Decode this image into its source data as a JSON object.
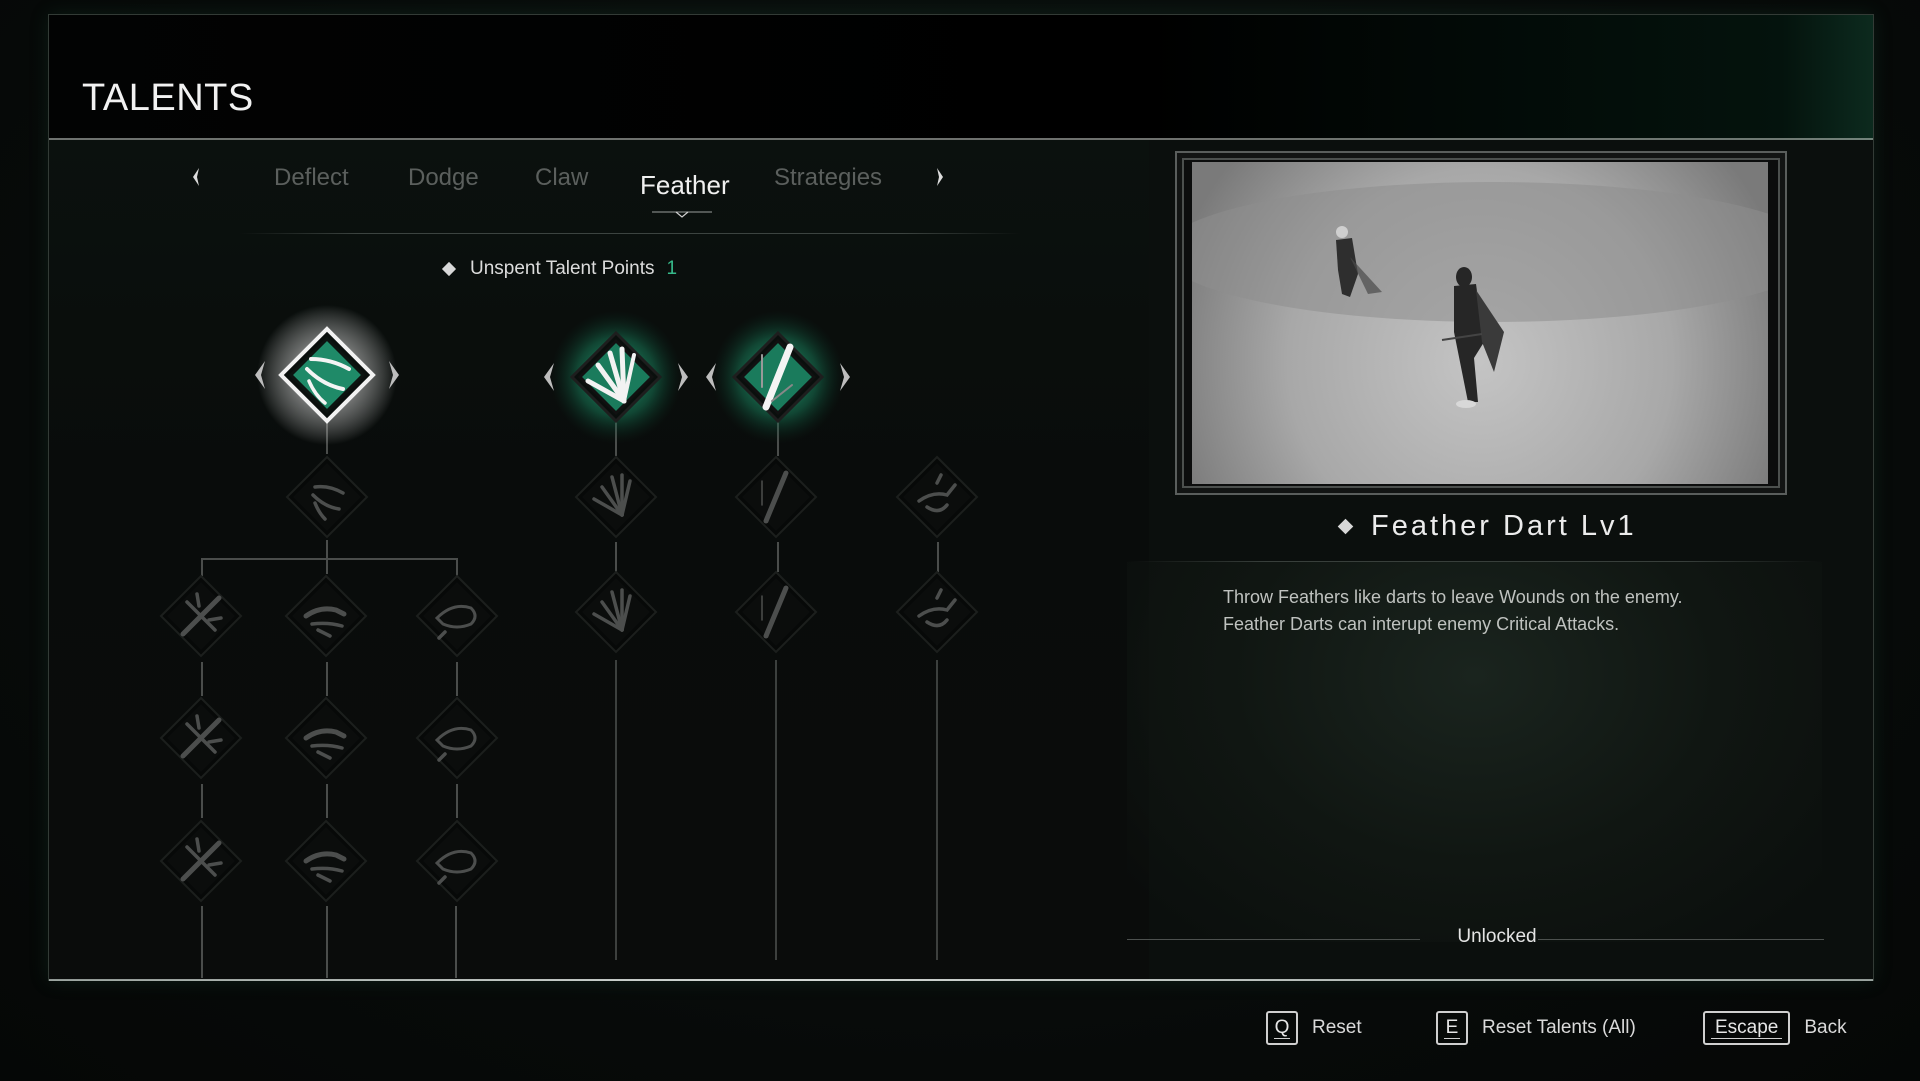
{
  "header": {
    "title": "TALENTS"
  },
  "tabs": {
    "prev_icon": "chevron-left-icon",
    "next_icon": "chevron-right-icon",
    "items": [
      {
        "label": "Deflect",
        "active": false
      },
      {
        "label": "Dodge",
        "active": false
      },
      {
        "label": "Claw",
        "active": false
      },
      {
        "label": "Feather",
        "active": true
      },
      {
        "label": "Strategies",
        "active": false
      }
    ]
  },
  "unspent": {
    "label": "Unspent Talent Points",
    "value": "1"
  },
  "tree": {
    "top_nodes": [
      {
        "id": "feather-dart",
        "state": "selected",
        "icon": "three-claws-icon",
        "has_level_arrows": true
      },
      {
        "id": "feather-fan",
        "state": "unlocked",
        "icon": "feather-fan-icon",
        "has_level_arrows": true
      },
      {
        "id": "single-feather",
        "state": "unlocked",
        "icon": "single-feather-icon",
        "has_level_arrows": true
      }
    ],
    "locked_nodes": [
      {
        "icon": "three-claws-icon"
      },
      {
        "icon": "feather-fan-icon"
      },
      {
        "icon": "single-feather-icon"
      },
      {
        "icon": "raven-icon"
      },
      {
        "icon": "crossed-feathers-icon"
      },
      {
        "icon": "bird-rider-icon"
      },
      {
        "icon": "beast-icon"
      },
      {
        "icon": "feather-fan-icon"
      },
      {
        "icon": "single-feather-icon"
      },
      {
        "icon": "raven-icon"
      },
      {
        "icon": "crossed-feathers-icon"
      },
      {
        "icon": "bird-rider-icon"
      },
      {
        "icon": "beast-icon"
      },
      {
        "icon": "crossed-feathers-icon"
      },
      {
        "icon": "bird-rider-icon"
      },
      {
        "icon": "beast-icon"
      }
    ]
  },
  "detail": {
    "title": "Feather Dart Lv1",
    "description": [
      "Throw Feathers like darts to leave Wounds on the enemy.",
      "Feather Darts can interupt enemy Critical Attacks."
    ],
    "status": "Unlocked",
    "preview_alt": "Character throwing feather darts at an enemy in fog"
  },
  "hints": [
    {
      "key": "Q",
      "label": "Reset"
    },
    {
      "key": "E",
      "label": "Reset Talents (All)"
    },
    {
      "key": "Escape",
      "label": "Back"
    }
  ],
  "colors": {
    "accent_green": "#1f8a68",
    "glow_green": "#2fd39a",
    "unspent_value": "#36b98a"
  }
}
